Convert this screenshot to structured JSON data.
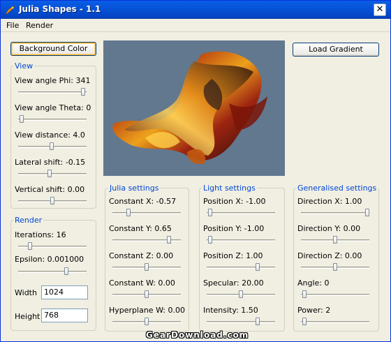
{
  "window": {
    "title": "Julia Shapes - 1.1",
    "close": "✕"
  },
  "menu": {
    "file": "File",
    "render": "Render"
  },
  "buttons": {
    "background_color": "Background Color",
    "load_gradient": "Load Gradient"
  },
  "view": {
    "label": "View",
    "phi": "View angle Phi: 341",
    "theta": "View angle Theta: 0",
    "distance": "View distance: 4.0",
    "lateral": "Lateral shift: -0.15",
    "vertical": "Vertical shift: 0.00"
  },
  "render_group": {
    "label": "Render",
    "iterations": "Iterations: 16",
    "epsilon": "Epsilon: 0.001000",
    "width_label": "Width",
    "width_value": "1024",
    "height_label": "Height",
    "height_value": "768"
  },
  "julia": {
    "label": "Julia settings",
    "cx": "Constant X: -0.57",
    "cy": "Constant Y: 0.65",
    "cz": "Constant Z: 0.00",
    "cw": "Constant W: 0.00",
    "hw": "Hyperplane W: 0.00"
  },
  "light": {
    "label": "Light settings",
    "px": "Position X: -1.00",
    "py": "Position Y: -1.00",
    "pz": "Position Z: 1.00",
    "spec": "Specular: 20.00",
    "intensity": "Intensity: 1.50"
  },
  "gen": {
    "label": "Generalised settings",
    "dx": "Direction X: 1.00",
    "dy": "Direction Y: 0.00",
    "dz": "Direction Z: 0.00",
    "angle": "Angle: 0",
    "power": "Power: 2"
  },
  "watermark": "GearDownload.com",
  "colors": {
    "titlebar": "#0a5ee8",
    "group_label": "#0046d5",
    "render_bg": "#61788f"
  },
  "icons": {
    "app": "julia-app-icon",
    "close": "close-icon"
  }
}
